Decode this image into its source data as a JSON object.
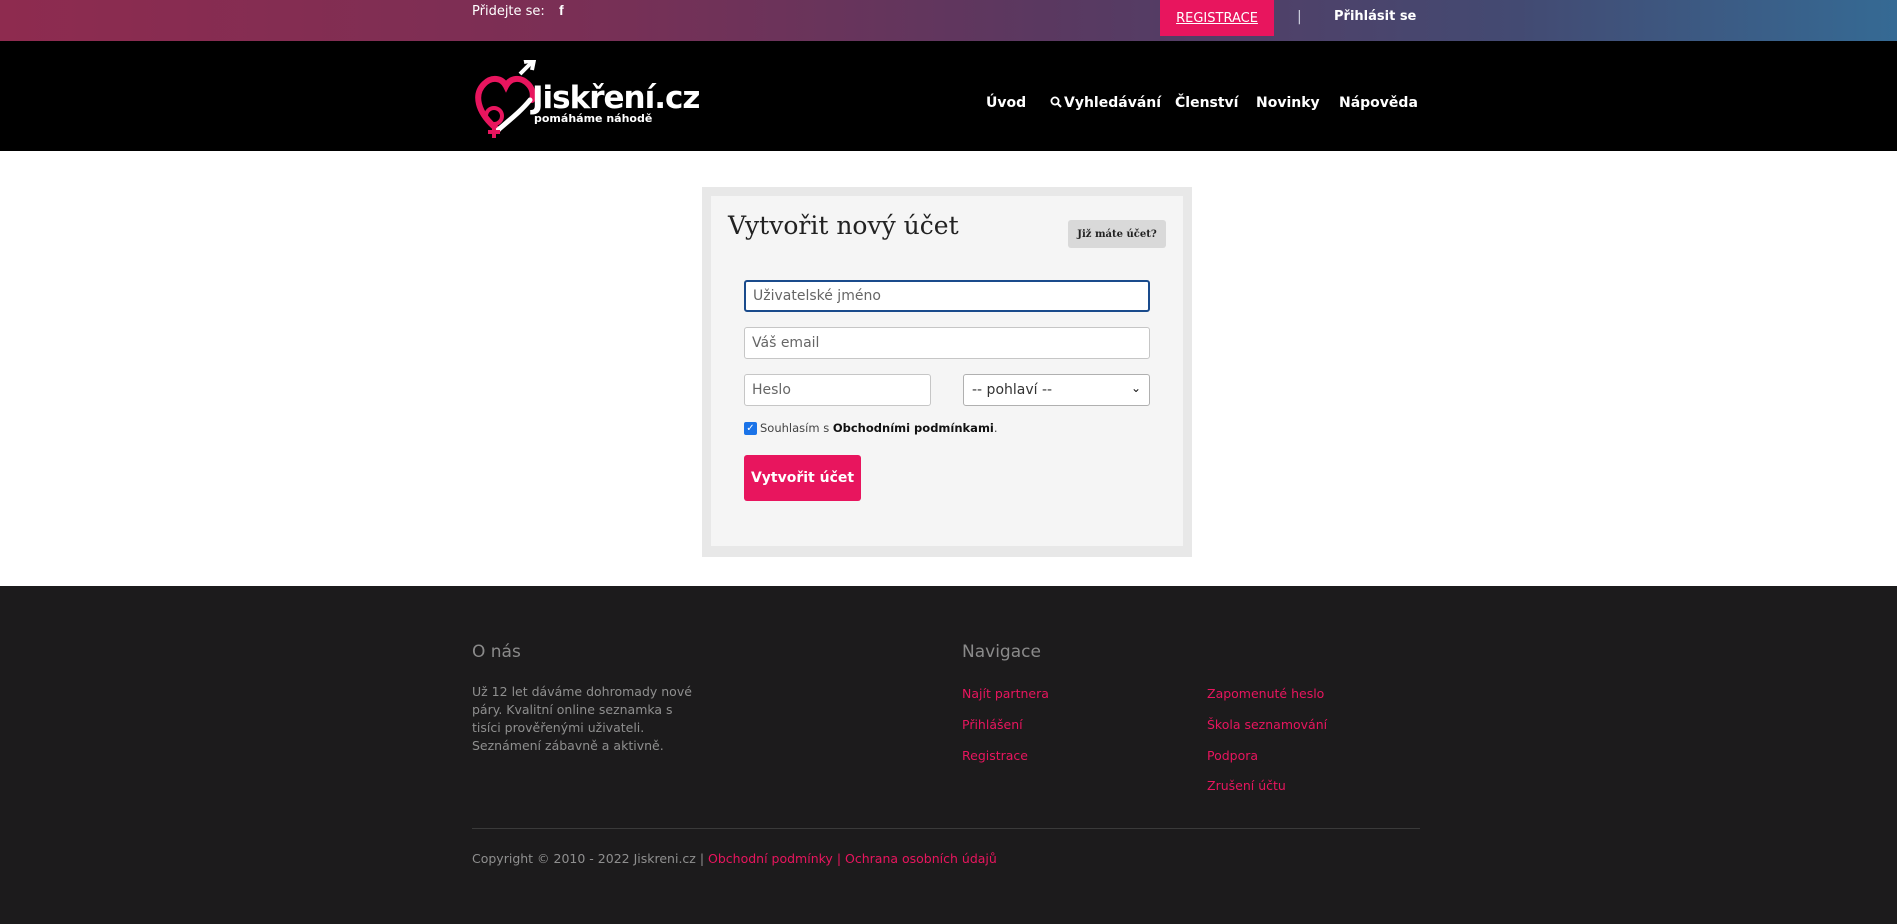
{
  "topbar": {
    "join_label": "Přidejte se:",
    "facebook_icon": "facebook-icon",
    "register_button": "REGISTRACE",
    "separator": "|",
    "login_link": "Přihlásit se"
  },
  "header": {
    "logo_text": "Jiskření.cz",
    "logo_tagline": "pomáháme náhodě",
    "nav": [
      {
        "label": "Úvod"
      },
      {
        "label": "Vyhledávání",
        "icon": "search-icon"
      },
      {
        "label": "Členství"
      },
      {
        "label": "Novinky"
      },
      {
        "label": "Nápověda"
      }
    ]
  },
  "form": {
    "title": "Vytvořit nový účet",
    "already_button": "Již máte účet?",
    "username_placeholder": "Uživatelské jméno",
    "email_placeholder": "Váš email",
    "password_placeholder": "Heslo",
    "gender_selected": "-- pohlaví --",
    "consent_checked": true,
    "consent_text": "Souhlasím s",
    "consent_link": "Obchodními podmínkami",
    "consent_period": ".",
    "submit": "Vytvořit účet"
  },
  "footer": {
    "about_heading": "O nás",
    "about_text": "Už 12 let dáváme dohromady nové páry. Kvalitní online seznamka s tisíci prověřenými uživateli. Seznámení zábavně a aktivně.",
    "nav_heading": "Navigace",
    "nav_col1": [
      "Najít partnera",
      "Přihlášení",
      "Registrace"
    ],
    "nav_col2": [
      "Zapomenuté heslo",
      "Škola seznamování",
      "Podpora",
      "Zrušení účtu"
    ],
    "copyright": "Copyright © 2010 - 2022 Jiskreni.cz |",
    "terms_link": "Obchodní podmínky",
    "sep": "|",
    "privacy_link": "Ochrana osobních údajů"
  },
  "colors": {
    "accent": "#e8155e",
    "header_bg": "#000000",
    "footer_bg": "#1c1b1c"
  }
}
